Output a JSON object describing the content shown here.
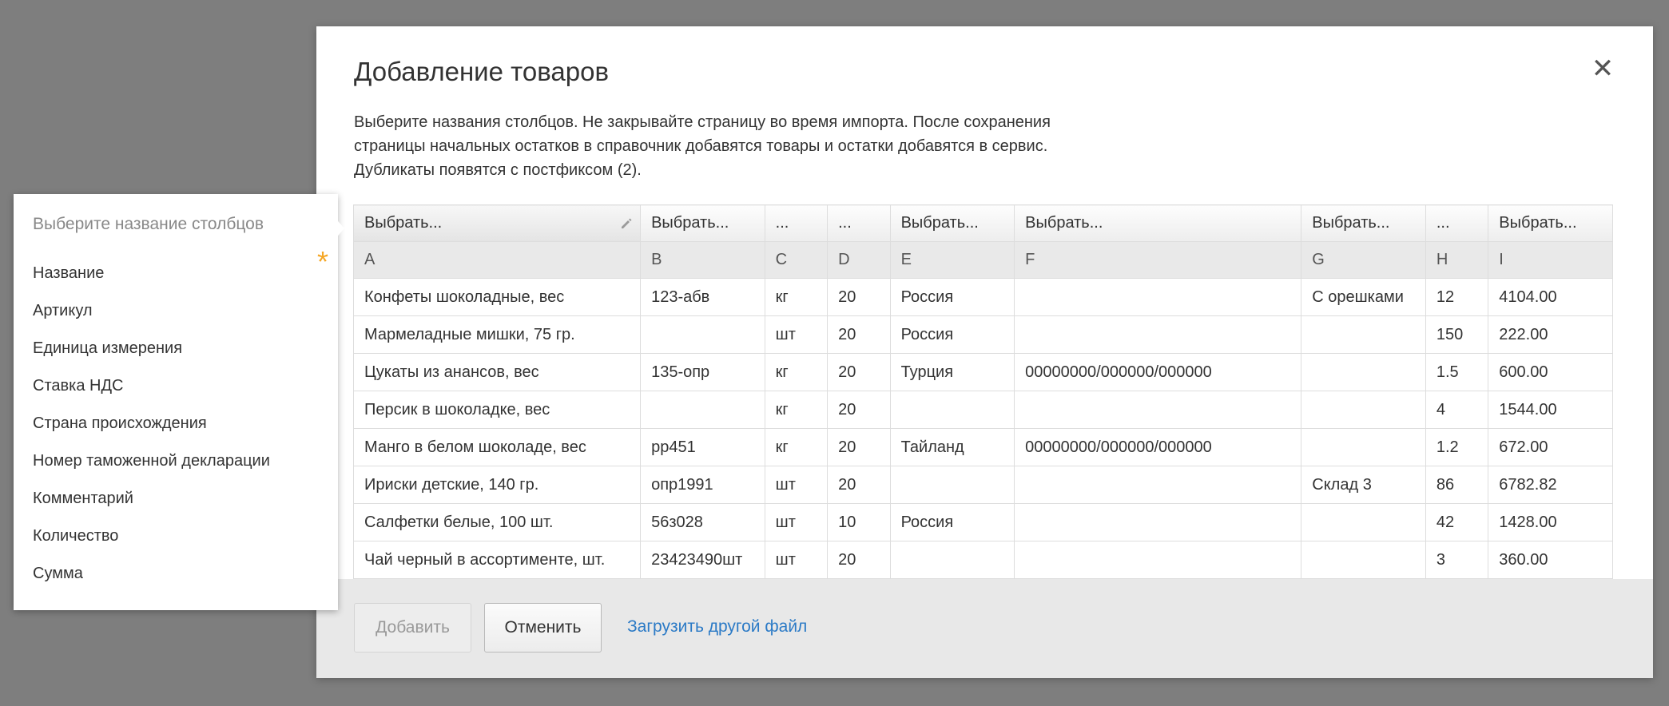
{
  "dialog": {
    "title": "Добавление товаров",
    "description_lines": [
      "Выберите названия столбцов. Не закрывайте страницу во время импорта. После сохранения",
      "страницы начальных остатков в справочник добавятся товары и остатки добавятся в сервис.",
      "Дубликаты появятся с постфиксом (2)."
    ],
    "close_symbol": "✕"
  },
  "table": {
    "select_labels": [
      "Выбрать...",
      "Выбрать...",
      "...",
      "...",
      "Выбрать...",
      "Выбрать...",
      "Выбрать...",
      "...",
      "Выбрать..."
    ],
    "letters": [
      "A",
      "B",
      "C",
      "D",
      "E",
      "F",
      "G",
      "H",
      "I"
    ],
    "rows": [
      [
        "Конфеты шоколадные, вес",
        "123-абв",
        "кг",
        "20",
        "Россия",
        "",
        "С орешками",
        "12",
        "4104.00"
      ],
      [
        "Мармеладные мишки, 75 гр.",
        "",
        "шт",
        "20",
        "Россия",
        "",
        "",
        "150",
        "222.00"
      ],
      [
        "Цукаты из анансов, вес",
        "135-опр",
        "кг",
        "20",
        "Турция",
        "00000000/000000/000000",
        "",
        "1.5",
        "600.00"
      ],
      [
        "Персик в шоколадке, вес",
        "",
        "кг",
        "20",
        "",
        "",
        "",
        "4",
        "1544.00"
      ],
      [
        "Манго в белом шоколаде, вес",
        "рр451",
        "кг",
        "20",
        "Тайланд",
        "00000000/000000/000000",
        "",
        "1.2",
        "672.00"
      ],
      [
        "Ириски детские, 140 гр.",
        "опр1991",
        "шт",
        "20",
        "",
        "",
        "Склад 3",
        "86",
        "6782.82"
      ],
      [
        "Салфетки белые, 100 шт.",
        "56з028",
        "шт",
        "10",
        "Россия",
        "",
        "",
        "42",
        "1428.00"
      ],
      [
        "Чай черный в ассортименте, шт.",
        "23423490шт",
        "шт",
        "20",
        "",
        "",
        "",
        "3",
        "360.00"
      ]
    ]
  },
  "footer": {
    "add_label": "Добавить",
    "cancel_label": "Отменить",
    "upload_link": "Загрузить другой файл"
  },
  "dropdown": {
    "header": "Выберите название столбцов",
    "required_mark": "*",
    "items": [
      "Название",
      "Артикул",
      "Единица измерения",
      "Ставка НДС",
      "Страна происхождения",
      "Номер таможенной декларации",
      "Комментарий",
      "Количество",
      "Сумма"
    ]
  },
  "colors": {
    "overlay": "#7e7e7e",
    "link": "#2b7ac6",
    "required_star": "#f5a623",
    "footer_bg": "#e8e8e8"
  }
}
